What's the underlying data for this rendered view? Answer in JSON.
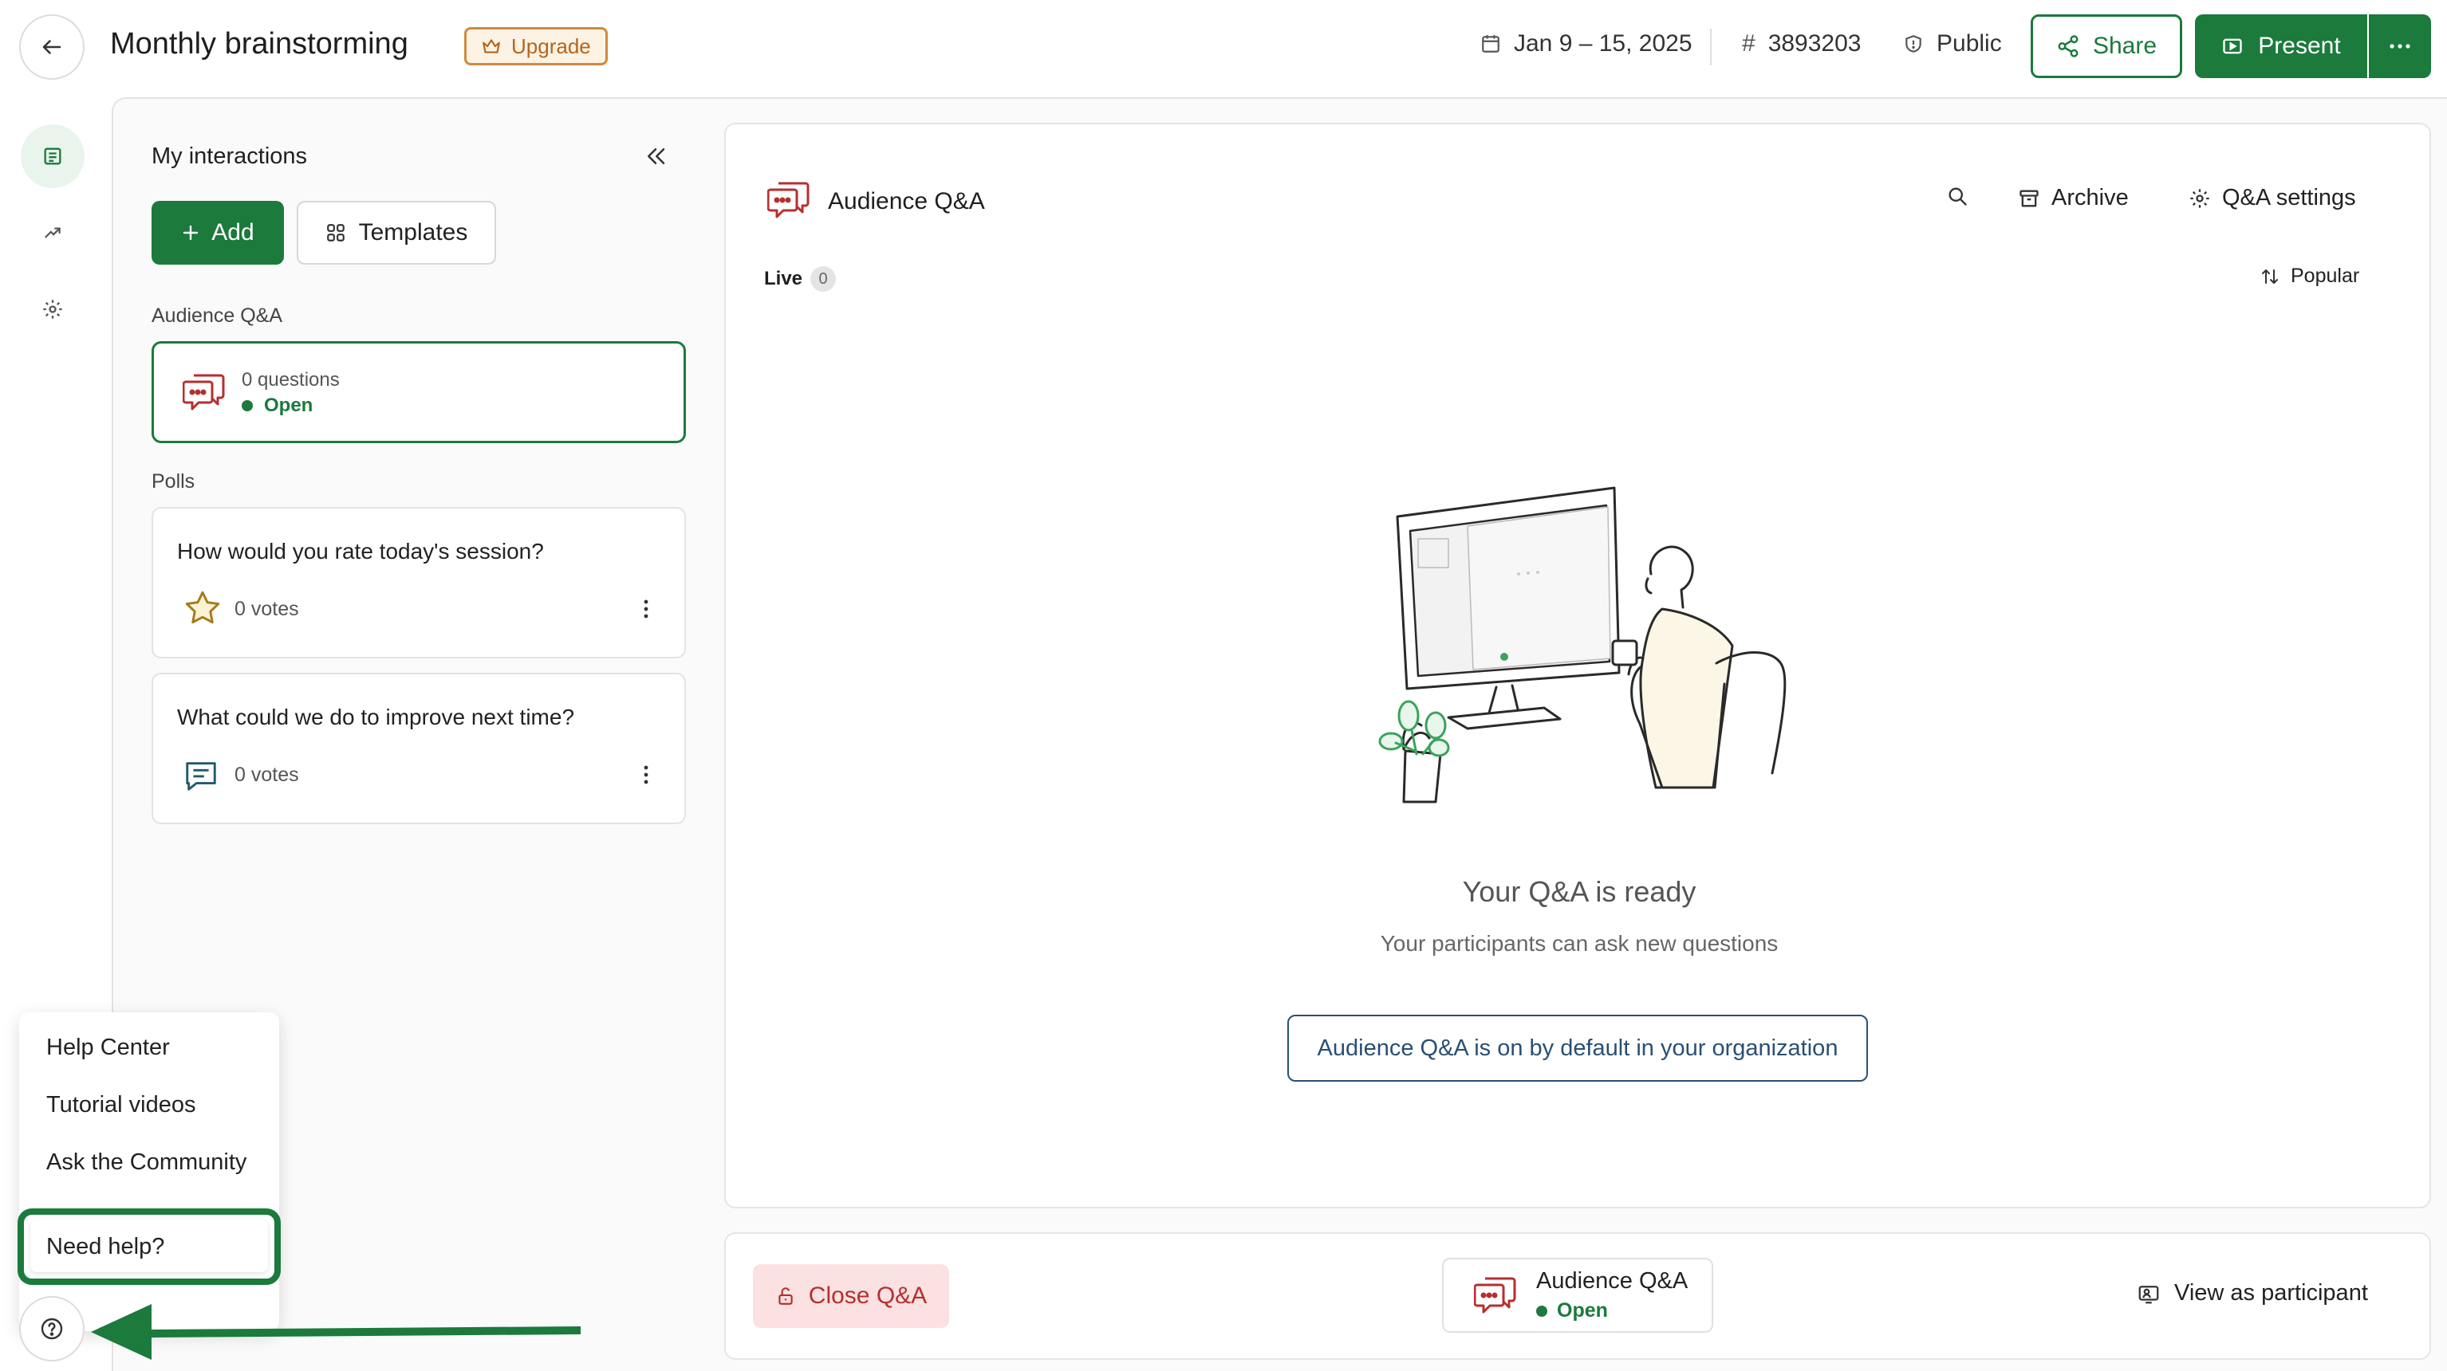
{
  "header": {
    "title": "Monthly brainstorming",
    "upgrade_label": "Upgrade",
    "date_range": "Jan 9 – 15, 2025",
    "event_code": "3893203",
    "visibility": "Public",
    "share_label": "Share",
    "present_label": "Present"
  },
  "sidebar": {
    "title": "My interactions",
    "add_label": "Add",
    "templates_label": "Templates",
    "qa_section": "Audience Q&A",
    "qa_card": {
      "questions": "0 questions",
      "status": "Open"
    },
    "polls_section": "Polls",
    "polls": [
      {
        "title": "How would you rate today's session?",
        "votes": "0 votes"
      },
      {
        "title": "What could we do to improve next time?",
        "votes": "0 votes"
      }
    ]
  },
  "main": {
    "title": "Audience Q&A",
    "archive_label": "Archive",
    "settings_label": "Q&A settings",
    "live_label": "Live",
    "live_count": "0",
    "sort_label": "Popular",
    "empty_title": "Your Q&A is ready",
    "empty_subtitle": "Your participants can ask new questions",
    "org_notice": "Audience Q&A is on by default in your organization"
  },
  "bottom_bar": {
    "close_label": "Close Q&A",
    "chip_title": "Audience Q&A",
    "chip_status": "Open",
    "participant_label": "View as participant"
  },
  "help_menu": {
    "items": [
      "Help Center",
      "Tutorial videos",
      "Ask the Community"
    ],
    "need_help": "Need help?"
  },
  "colors": {
    "brand_green": "#1b7a3c",
    "danger_red": "#b62f2f",
    "upgrade_orange": "#d08a3c",
    "notice_blue": "#2a4f74"
  },
  "icons": [
    "back-arrow-icon",
    "crown-icon",
    "calendar-icon",
    "hash-icon",
    "shield-icon",
    "share-icon",
    "present-icon",
    "more-dots-icon",
    "list-icon",
    "trend-icon",
    "gear-icon",
    "double-chevron-left-icon",
    "plus-icon",
    "grid-icon",
    "chat-bubble-icon",
    "star-icon",
    "comment-lines-icon",
    "kebab-icon",
    "search-icon",
    "archive-icon",
    "sort-icon",
    "lock-open-icon",
    "participant-icon",
    "help-question-icon"
  ]
}
